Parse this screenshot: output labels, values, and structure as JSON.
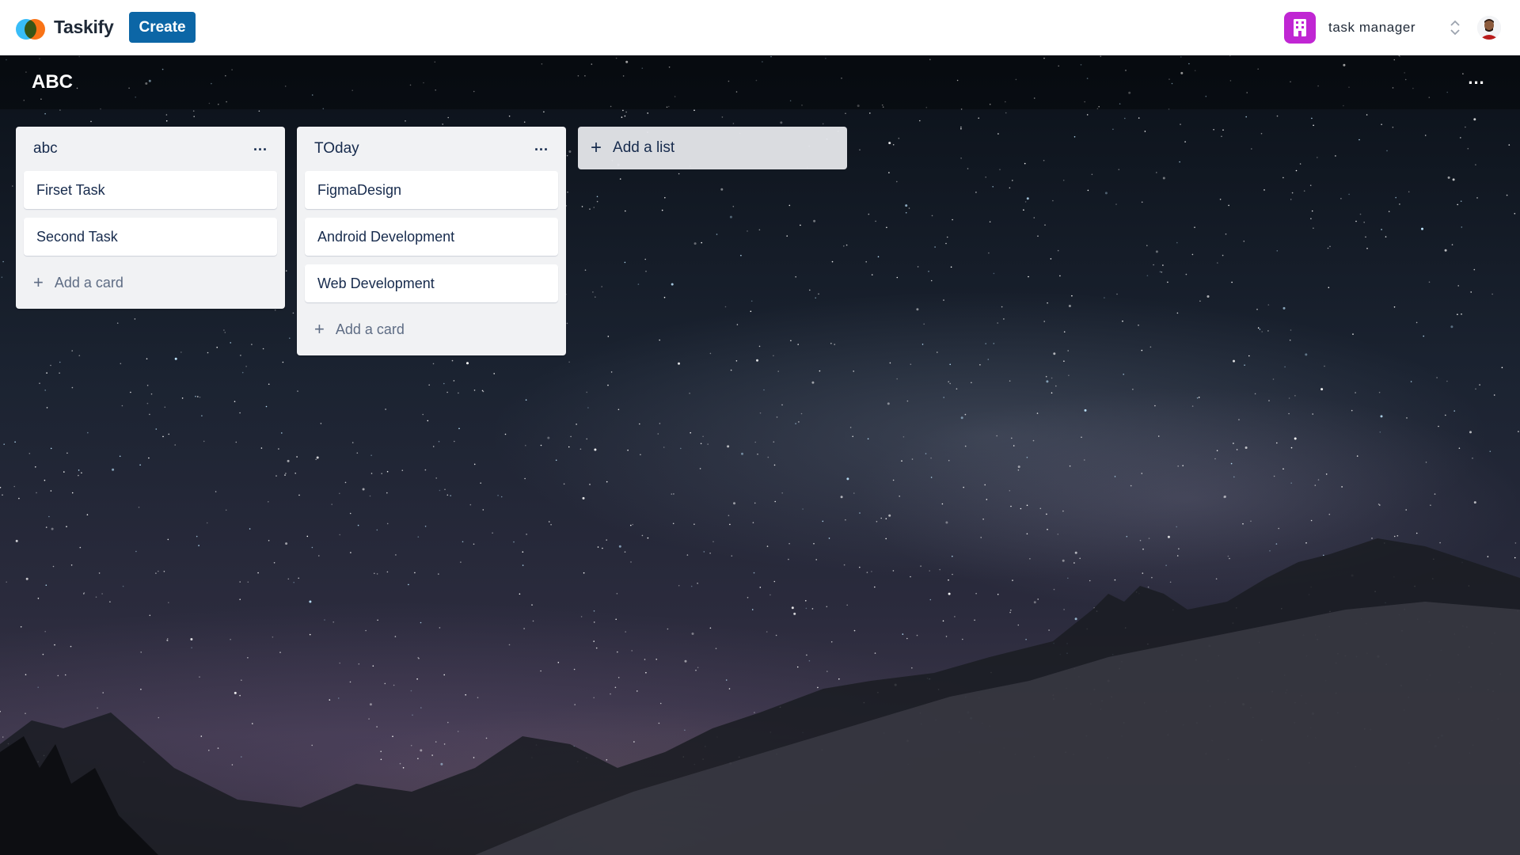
{
  "app": {
    "name": "Taskify",
    "create_label": "Create"
  },
  "workspace": {
    "name": "task manager"
  },
  "board": {
    "title": "ABC",
    "menu_label": "..."
  },
  "lists": [
    {
      "title": "abc",
      "menu_label": "...",
      "cards": [
        "Firset Task",
        "Second Task"
      ],
      "add_card_label": "Add a card"
    },
    {
      "title": "TOday",
      "menu_label": "...",
      "cards": [
        "FigmaDesign",
        "Android Development",
        "Web Development"
      ],
      "add_card_label": "Add a card"
    }
  ],
  "add_list_label": "Add a list",
  "icons": {
    "org": "building-icon",
    "switch": "chevron-up-down-icon",
    "plus": "plus-icon",
    "more": "more-horizontal-icon"
  },
  "colors": {
    "create_button": "#0c66a6",
    "org_icon": "#c026d3",
    "list_bg": "#f1f2f4"
  }
}
